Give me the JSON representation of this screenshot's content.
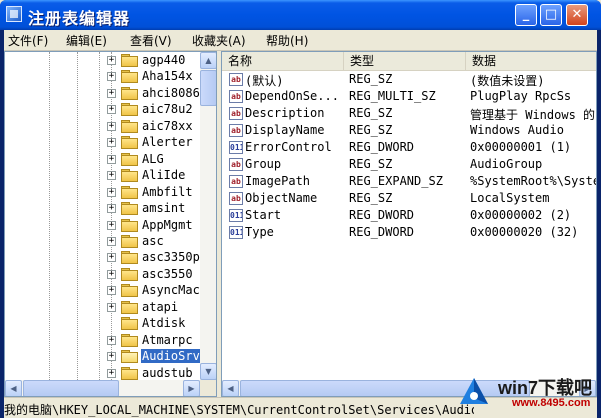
{
  "window": {
    "title": "注册表编辑器",
    "min_glyph": "_",
    "max_glyph": "□",
    "close_glyph": "✕"
  },
  "menu": [
    {
      "label": "文件(F)"
    },
    {
      "label": "编辑(E)"
    },
    {
      "label": "查看(V)"
    },
    {
      "label": "收藏夹(A)"
    },
    {
      "label": "帮助(H)"
    }
  ],
  "tree": {
    "items": [
      {
        "label": "agp440",
        "expander": "+"
      },
      {
        "label": "Aha154x",
        "expander": "+"
      },
      {
        "label": "ahci8086",
        "expander": "+"
      },
      {
        "label": "aic78u2",
        "expander": "+"
      },
      {
        "label": "aic78xx",
        "expander": "+"
      },
      {
        "label": "Alerter",
        "expander": "+"
      },
      {
        "label": "ALG",
        "expander": "+"
      },
      {
        "label": "AliIde",
        "expander": "+"
      },
      {
        "label": "Ambfilt",
        "expander": "+"
      },
      {
        "label": "amsint",
        "expander": "+"
      },
      {
        "label": "AppMgmt",
        "expander": "+"
      },
      {
        "label": "asc",
        "expander": "+"
      },
      {
        "label": "asc3350p",
        "expander": "+"
      },
      {
        "label": "asc3550",
        "expander": "+"
      },
      {
        "label": "AsyncMac",
        "expander": "+"
      },
      {
        "label": "atapi",
        "expander": "+"
      },
      {
        "label": "Atdisk",
        "expander": ""
      },
      {
        "label": "Atmarpc",
        "expander": "+"
      },
      {
        "label": "AudioSrv",
        "expander": "+",
        "selected": true
      },
      {
        "label": "audstub",
        "expander": "+"
      }
    ]
  },
  "list": {
    "headers": {
      "name": "名称",
      "type": "类型",
      "data": "数据"
    },
    "rows": [
      {
        "icon": "ab",
        "name": "(默认)",
        "type": "REG_SZ",
        "data": "(数值未设置)"
      },
      {
        "icon": "ab",
        "name": "DependOnSe...",
        "type": "REG_MULTI_SZ",
        "data": "PlugPlay RpcSs"
      },
      {
        "icon": "ab",
        "name": "Description",
        "type": "REG_SZ",
        "data": "管理基于 Windows 的"
      },
      {
        "icon": "ab",
        "name": "DisplayName",
        "type": "REG_SZ",
        "data": "Windows Audio"
      },
      {
        "icon": "bin",
        "name": "ErrorControl",
        "type": "REG_DWORD",
        "data": "0x00000001 (1)"
      },
      {
        "icon": "ab",
        "name": "Group",
        "type": "REG_SZ",
        "data": "AudioGroup"
      },
      {
        "icon": "ab",
        "name": "ImagePath",
        "type": "REG_EXPAND_SZ",
        "data": "%SystemRoot%\\Syste"
      },
      {
        "icon": "ab",
        "name": "ObjectName",
        "type": "REG_SZ",
        "data": "LocalSystem"
      },
      {
        "icon": "bin",
        "name": "Start",
        "type": "REG_DWORD",
        "data": "0x00000002 (2)"
      },
      {
        "icon": "bin",
        "name": "Type",
        "type": "REG_DWORD",
        "data": "0x00000020 (32)"
      }
    ]
  },
  "status": {
    "path": "我的电脑\\HKEY_LOCAL_MACHINE\\SYSTEM\\CurrentControlSet\\Services\\AudioSrv"
  },
  "watermark": {
    "brand": "win7下载吧",
    "url": "www.8495.com"
  },
  "colors": {
    "titlebar": "#0054E3",
    "selection": "#316AC5",
    "close_button": "#D4441C"
  }
}
